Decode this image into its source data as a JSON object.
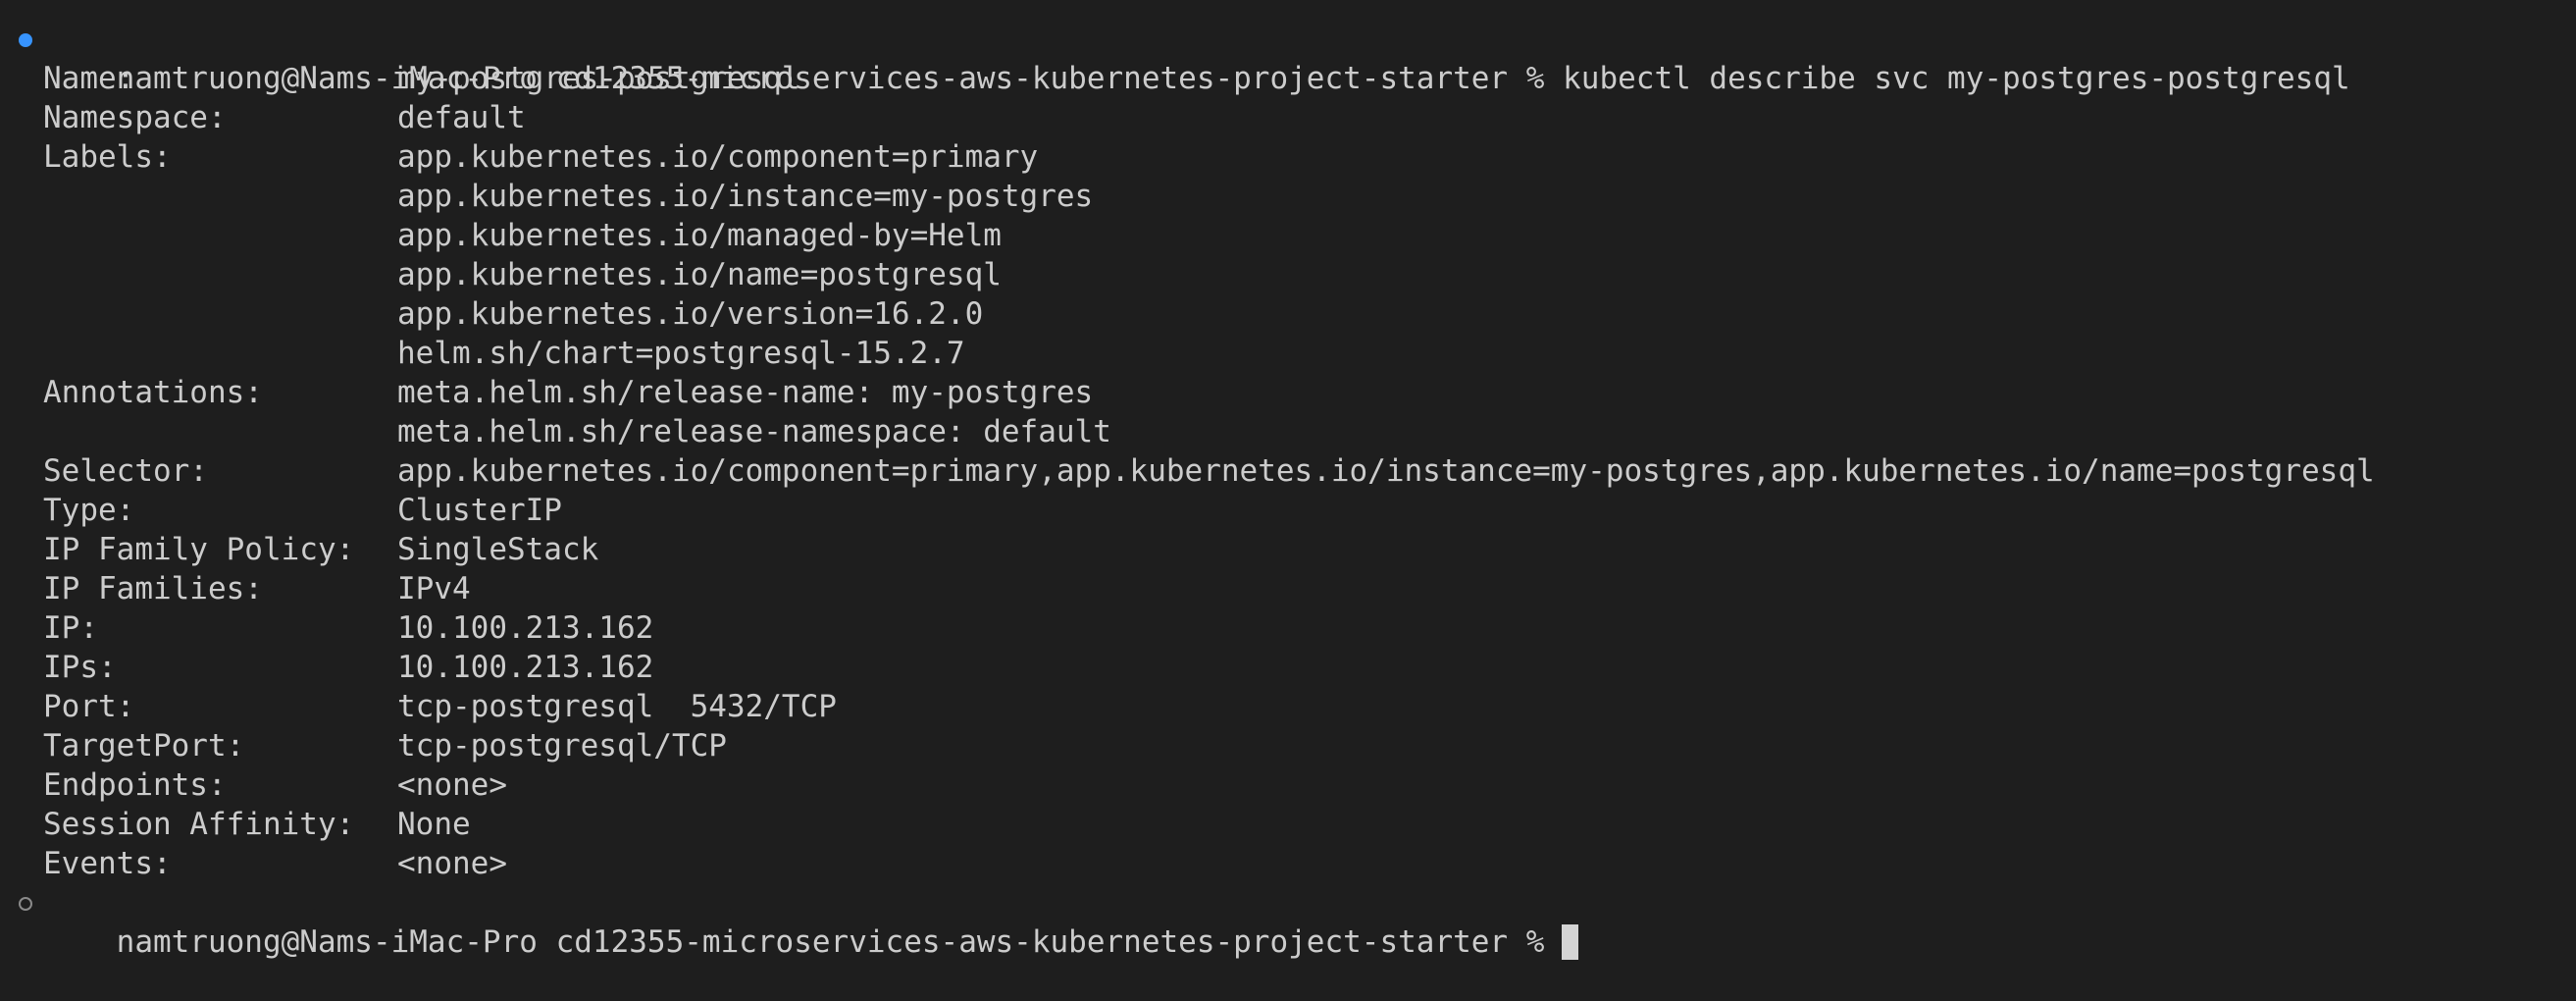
{
  "prompt": {
    "user_host": "namtruong@Nams-iMac-Pro",
    "cwd": "cd12355-microservices-aws-kubernetes-project-starter",
    "symbol": "%",
    "command": "kubectl describe svc my-postgres-postgresql"
  },
  "colors": {
    "background": "#1e1e1e",
    "text": "#cccccc",
    "success_marker": "#3794ff",
    "idle_marker": "#8a8a8a"
  },
  "output": [
    {
      "key": "Name:",
      "value": "my-postgres-postgresql"
    },
    {
      "key": "Namespace:",
      "value": "default"
    },
    {
      "key": "Labels:",
      "value": "app.kubernetes.io/component=primary"
    },
    {
      "key": "",
      "value": "app.kubernetes.io/instance=my-postgres"
    },
    {
      "key": "",
      "value": "app.kubernetes.io/managed-by=Helm"
    },
    {
      "key": "",
      "value": "app.kubernetes.io/name=postgresql"
    },
    {
      "key": "",
      "value": "app.kubernetes.io/version=16.2.0"
    },
    {
      "key": "",
      "value": "helm.sh/chart=postgresql-15.2.7"
    },
    {
      "key": "Annotations:",
      "value": "meta.helm.sh/release-name: my-postgres"
    },
    {
      "key": "",
      "value": "meta.helm.sh/release-namespace: default"
    },
    {
      "key": "Selector:",
      "value": "app.kubernetes.io/component=primary,app.kubernetes.io/instance=my-postgres,app.kubernetes.io/name=postgresql"
    },
    {
      "key": "Type:",
      "value": "ClusterIP"
    },
    {
      "key": "IP Family Policy:",
      "value": "SingleStack"
    },
    {
      "key": "IP Families:",
      "value": "IPv4"
    },
    {
      "key": "IP:",
      "value": "10.100.213.162"
    },
    {
      "key": "IPs:",
      "value": "10.100.213.162"
    },
    {
      "key": "Port:",
      "value": "tcp-postgresql  5432/TCP"
    },
    {
      "key": "TargetPort:",
      "value": "tcp-postgresql/TCP"
    },
    {
      "key": "Endpoints:",
      "value": "<none>"
    },
    {
      "key": "Session Affinity:",
      "value": "None"
    },
    {
      "key": "Events:",
      "value": "<none>"
    }
  ]
}
